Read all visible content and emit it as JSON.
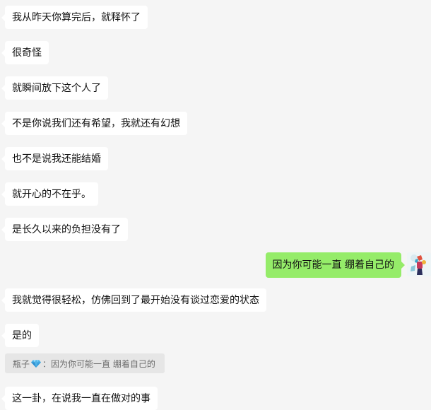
{
  "messages": [
    {
      "side": "in",
      "text": "我从昨天你算完后，就释怀了"
    },
    {
      "side": "in",
      "text": "很奇怪"
    },
    {
      "side": "in",
      "text": "就瞬间放下这个人了"
    },
    {
      "side": "in",
      "text": "不是你说我们还有希望，我就还有幻想"
    },
    {
      "side": "in",
      "text": "也不是说我还能结婚"
    },
    {
      "side": "in",
      "text": "就开心的不在乎。"
    },
    {
      "side": "in",
      "text": "是长久以来的负担没有了"
    },
    {
      "side": "out",
      "text": "因为你可能一直 绷着自己的"
    },
    {
      "side": "in",
      "text": "我就觉得很轻松，仿佛回到了最开始没有谈过恋爱的状态"
    },
    {
      "side": "in",
      "text": "是的"
    },
    {
      "side": "in",
      "text": "这一卦，在说我一直在做对的事"
    }
  ],
  "quote": {
    "sender": "瓶子",
    "emoji_icon": "gem-stone-icon",
    "separator": "：",
    "text": "因为你可能一直 绷着自己的"
  },
  "colors": {
    "background": "#f5f5f5",
    "incoming_bubble": "#ffffff",
    "outgoing_bubble": "#95ec69",
    "quote_background": "#e6e6e6"
  }
}
